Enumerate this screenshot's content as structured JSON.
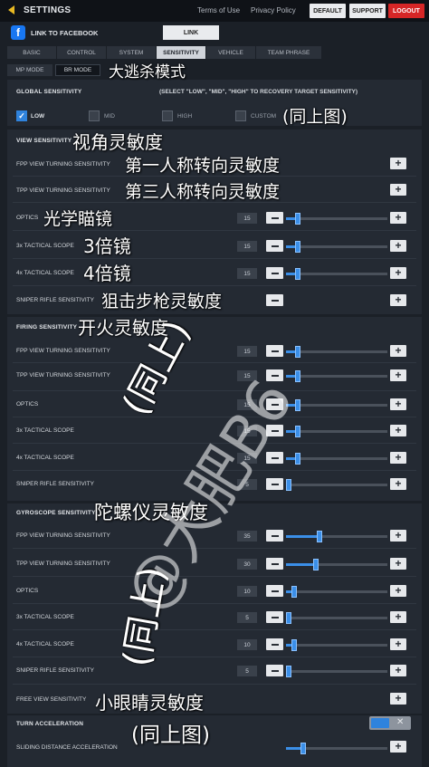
{
  "header": {
    "title": "SETTINGS",
    "terms": "Terms of Use",
    "privacy": "Privacy Policy",
    "default_btn": "DEFAULT",
    "support_btn": "SUPPORT",
    "logout_btn": "LOGOUT"
  },
  "facebook": {
    "icon": "f",
    "label": "LINK TO FACEBOOK",
    "button": "LINK"
  },
  "tabs": [
    "BASIC",
    "CONTROL",
    "SYSTEM",
    "SENSITIVITY",
    "VEHICLE",
    "TEAM PHRASE"
  ],
  "modes": [
    "MP MODE",
    "BR MODE"
  ],
  "global": {
    "title": "GLOBAL SENSITIVITY",
    "note": "(SELECT \"LOW\", \"MID\", \"HIGH\" TO RECOVERY TARGET SENSITIVITY)",
    "options": [
      "LOW",
      "MID",
      "HIGH",
      "CUSTOM"
    ]
  },
  "sections": {
    "view": "VIEW SENSITIVITY",
    "firing": "FIRING SENSITIVITY",
    "gyro": "GYROSCOPE SENSITIVITY",
    "turn": "TURN ACCELERATION"
  },
  "rows": {
    "v_fpp": {
      "label": "FPP VIEW TURNING SENSITIVITY",
      "value": ""
    },
    "v_tpp": {
      "label": "TPP VIEW TURNING SENSITIVITY",
      "value": ""
    },
    "v_optics": {
      "label": "OPTICS",
      "value": "15"
    },
    "v_3x": {
      "label": "3x TACTICAL SCOPE",
      "value": "15"
    },
    "v_4x": {
      "label": "4x TACTICAL SCOPE",
      "value": "15"
    },
    "v_sniper": {
      "label": "SNIPER RIFLE SENSITIVITY",
      "value": ""
    },
    "f_fpp": {
      "label": "FPP VIEW TURNING SENSITIVITY",
      "value": "15"
    },
    "f_tpp": {
      "label": "TPP VIEW TURNING SENSITIVITY",
      "value": "15"
    },
    "f_optics": {
      "label": "OPTICS",
      "value": "15"
    },
    "f_3x": {
      "label": "3x TACTICAL SCOPE",
      "value": "15"
    },
    "f_4x": {
      "label": "4x TACTICAL SCOPE",
      "value": "15"
    },
    "f_sniper": {
      "label": "SNIPER RIFLE SENSITIVITY",
      "value": "5"
    },
    "g_fpp": {
      "label": "FPP VIEW TURNING SENSITIVITY",
      "value": "35"
    },
    "g_tpp": {
      "label": "TPP VIEW TURNING SENSITIVITY",
      "value": "30"
    },
    "g_optics": {
      "label": "OPTICS",
      "value": "10"
    },
    "g_3x": {
      "label": "3x TACTICAL SCOPE",
      "value": "5"
    },
    "g_4x": {
      "label": "4x TACTICAL SCOPE",
      "value": "10"
    },
    "g_sniper": {
      "label": "SNIPER RIFLE SENSITIVITY",
      "value": "5"
    },
    "free_view": {
      "label": "FREE VIEW SENSITIVITY",
      "value": ""
    },
    "sliding": {
      "label": "SLIDING DISTANCE ACCELERATION",
      "value": ""
    }
  },
  "annotations": {
    "br_mode": "大逃杀模式",
    "same_as_above_1": "(同上图)",
    "view": "视角灵敏度",
    "fpp": "第一人称转向灵敏度",
    "tpp": "第三人称转向灵敏度",
    "optics": "光学瞄镜",
    "scope3": "3倍镜",
    "scope4": "4倍镜",
    "sniper": "狙击步枪灵敏度",
    "firing": "开火灵敏度",
    "same1": "(同上)",
    "gyro": "陀螺仪灵敏度",
    "same2": "(同上)",
    "free_view": "小眼睛灵敏度",
    "same_as_above_2": "(同上图)"
  },
  "watermark": "@大肥B6"
}
